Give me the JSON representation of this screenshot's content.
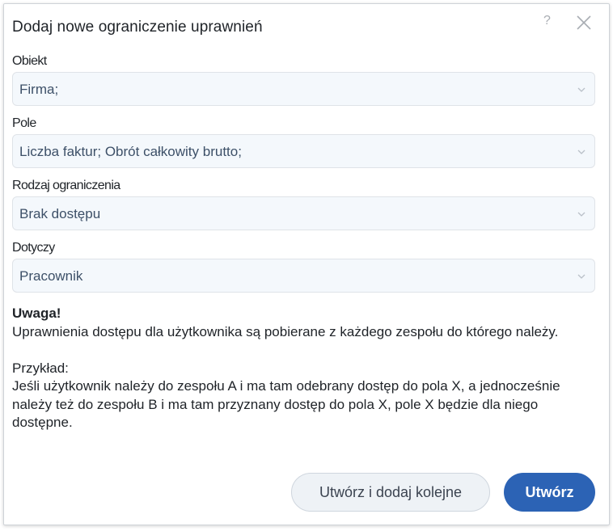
{
  "dialog": {
    "title": "Dodaj nowe ograniczenie uprawnień",
    "help_label": "?"
  },
  "fields": [
    {
      "label": "Obiekt",
      "value": "Firma;"
    },
    {
      "label": "Pole",
      "value": "Liczba faktur; Obrót całkowity brutto;"
    },
    {
      "label": "Rodzaj ograniczenia",
      "value": "Brak dostępu"
    },
    {
      "label": "Dotyczy",
      "value": "Pracownik"
    }
  ],
  "notice": {
    "heading": "Uwaga!",
    "line1": "Uprawnienia dostępu dla użytkownika są pobierane z każdego zespołu do którego należy.",
    "example_heading": "Przykład:",
    "example_text": "Jeśli użytkownik należy do zespołu A i ma tam odebrany dostęp do pola X, a jednocześnie należy też do zespołu B i ma tam przyznany dostęp do pola X, pole X będzie dla niego dostępne."
  },
  "buttons": {
    "create_and_add": "Utwórz i dodaj kolejne",
    "create": "Utwórz"
  },
  "colors": {
    "primary": "#2c63b5",
    "select_bg": "#f4f8fc",
    "select_text": "#3d5068"
  }
}
